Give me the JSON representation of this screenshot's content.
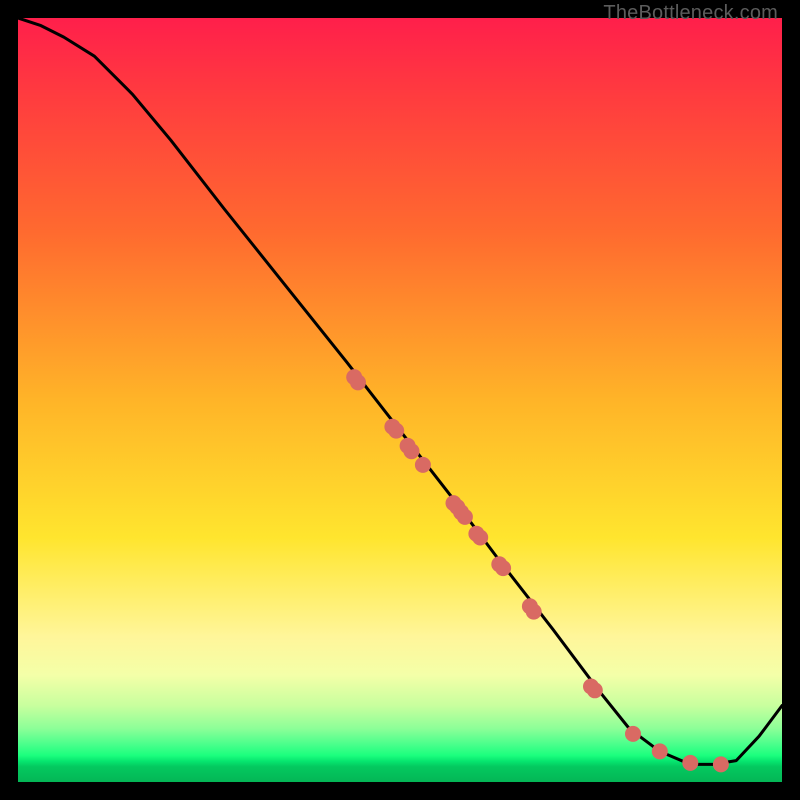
{
  "watermark": "TheBottleneck.com",
  "chart_data": {
    "type": "line",
    "title": "",
    "xlabel": "",
    "ylabel": "",
    "xlim": [
      0,
      100
    ],
    "ylim": [
      0,
      100
    ],
    "background_gradient": {
      "top": "#ff1f4b",
      "mid": "#ffe52e",
      "bottom": "#04b656",
      "description": "vertical rainbow gradient red→yellow→green representing quality band"
    },
    "series": [
      {
        "name": "bottleneck-curve",
        "color": "#000000",
        "x": [
          0,
          3,
          6,
          10,
          15,
          20,
          27,
          35,
          43,
          50,
          57,
          63,
          70,
          76,
          80,
          84,
          88,
          91,
          94,
          97,
          100
        ],
        "y": [
          100,
          99,
          97.5,
          95,
          90,
          84,
          75,
          65,
          55,
          46,
          37,
          29,
          20,
          12,
          7,
          4,
          2.3,
          2.3,
          2.8,
          6,
          10
        ]
      }
    ],
    "scatter_points": {
      "name": "benchmark-dots",
      "color": "#d96a63",
      "radius_px": 8,
      "x": [
        44,
        44.5,
        49,
        49.5,
        51,
        51.5,
        53,
        57,
        57.5,
        58,
        58.5,
        60,
        60.5,
        63,
        63.5,
        67,
        67.5,
        75,
        75.5,
        80.5,
        84,
        88,
        92
      ],
      "y": [
        53,
        52.3,
        46.5,
        46,
        44,
        43.3,
        41.5,
        36.5,
        36,
        35.3,
        34.7,
        32.5,
        32,
        28.5,
        28,
        23,
        22.3,
        12.5,
        12,
        6.3,
        4,
        2.5,
        2.3
      ]
    }
  }
}
